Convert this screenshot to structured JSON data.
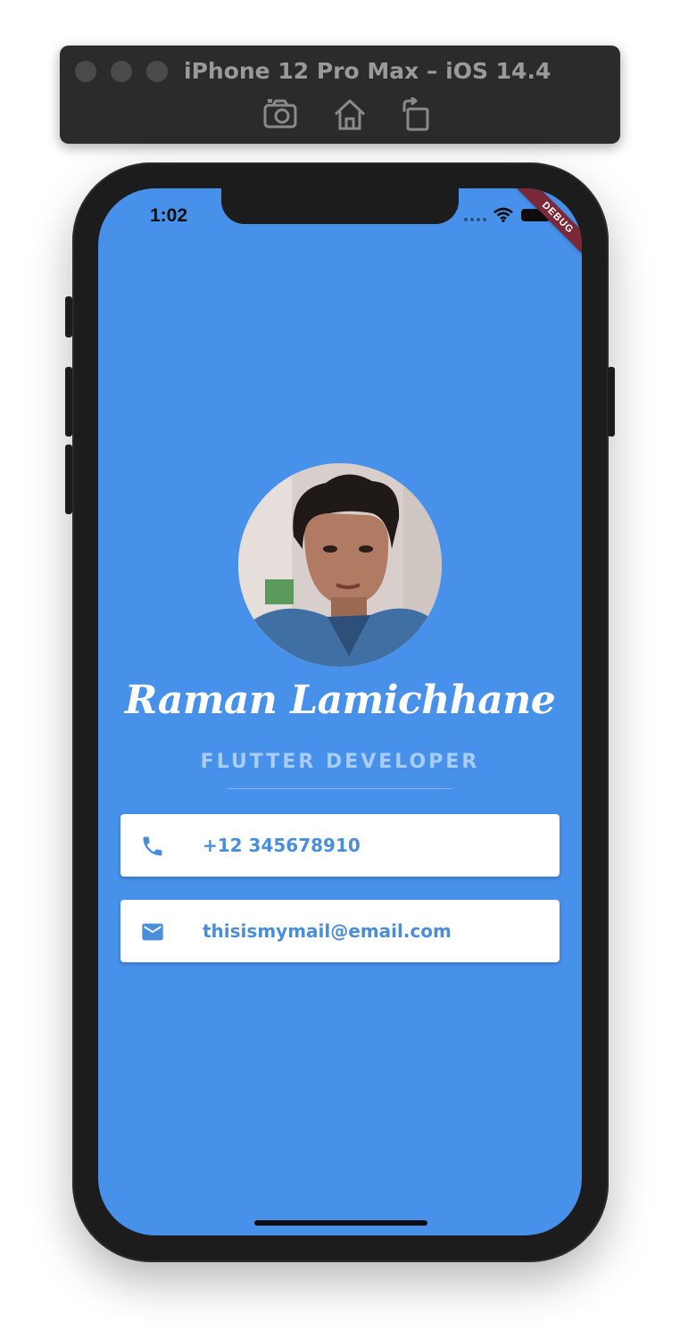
{
  "simulator": {
    "title": "iPhone 12 Pro Max – iOS 14.4",
    "controls": [
      "screenshot-icon",
      "home-icon",
      "rotate-icon"
    ]
  },
  "status_bar": {
    "time": "1:02",
    "debug_banner": "DEBUG"
  },
  "profile": {
    "name": "Raman Lamichhane",
    "role": "FLUTTER DEVELOPER",
    "phone": "+12 345678910",
    "email": "thisismymail@email.com"
  },
  "colors": {
    "background": "#4791eb",
    "card": "#ffffff",
    "accent_text": "#4a8ed9",
    "role_text": "#a9cdf5"
  }
}
